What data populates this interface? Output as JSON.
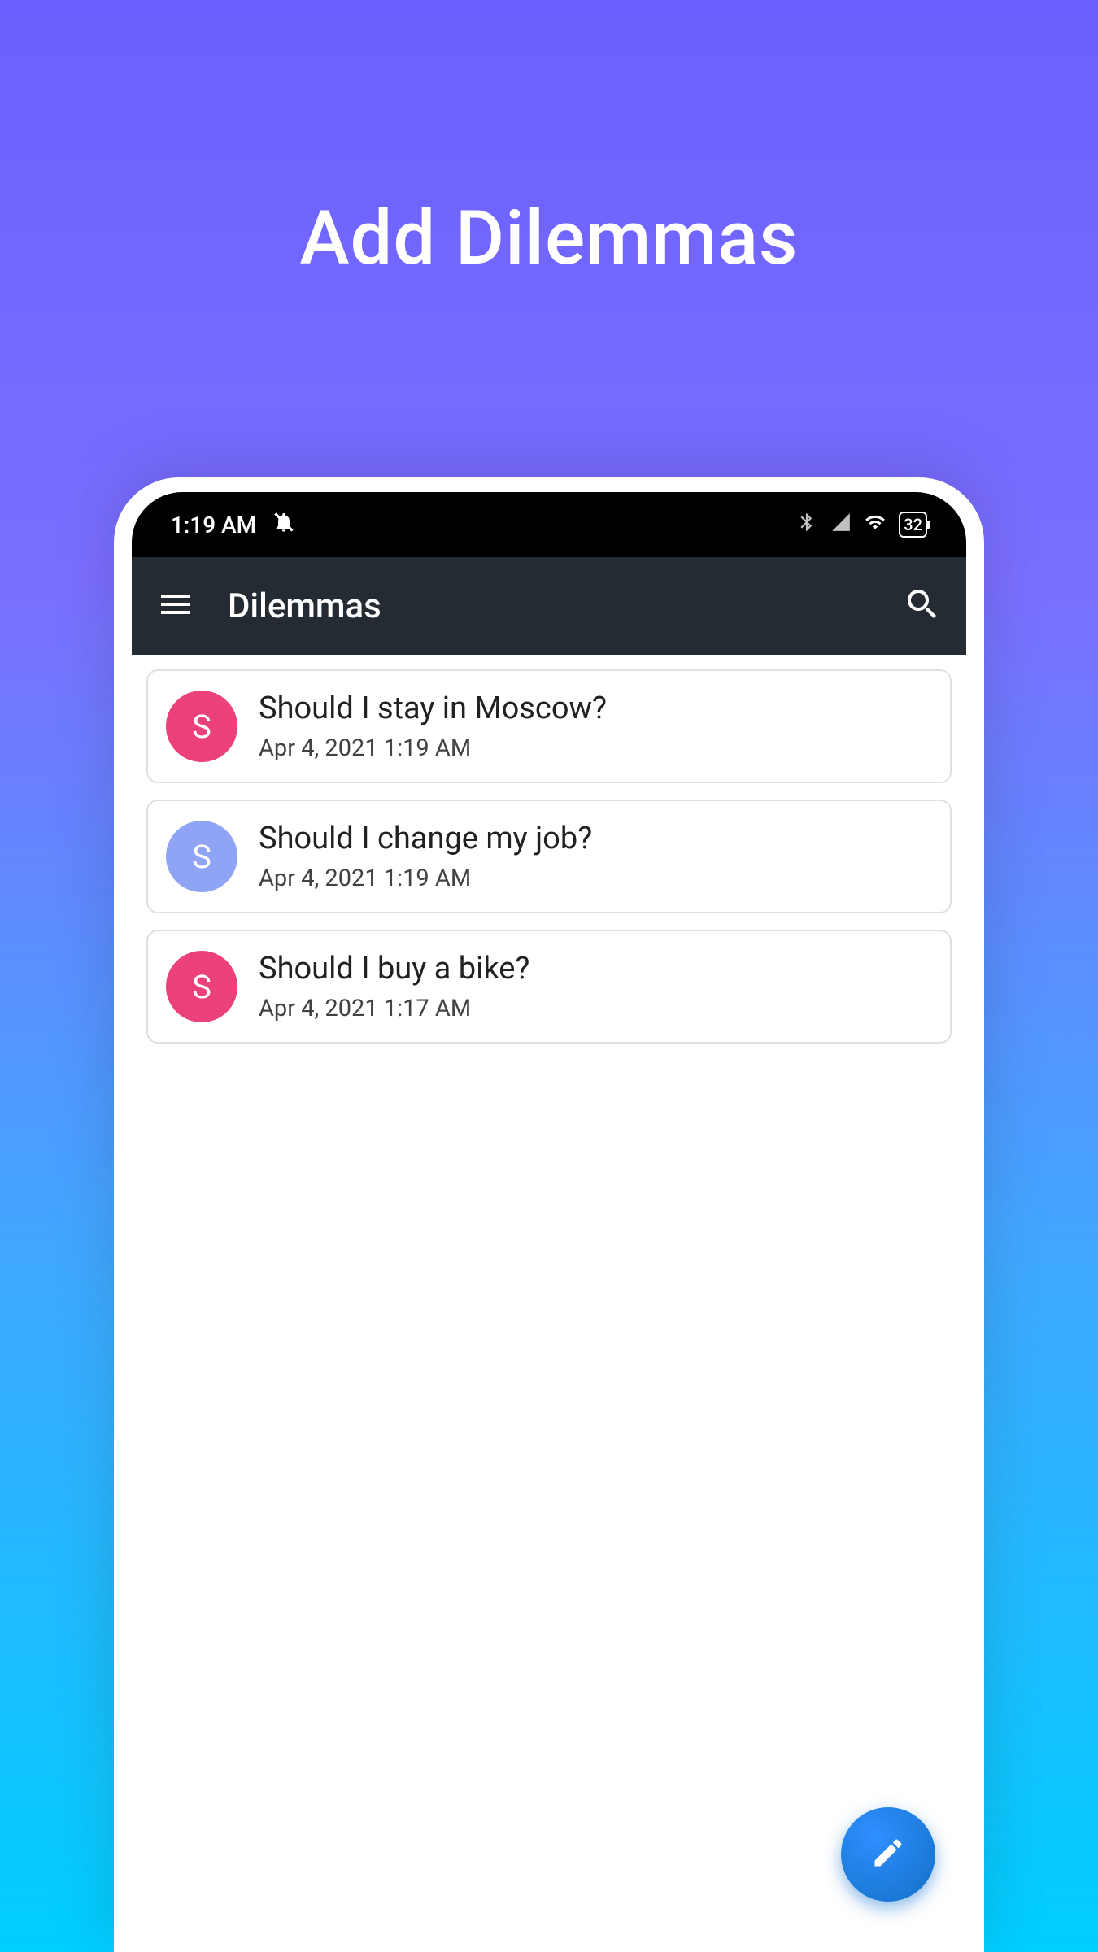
{
  "page": {
    "title": "Add Dilemmas"
  },
  "status_bar": {
    "time": "1:19 AM",
    "battery": "32"
  },
  "app_bar": {
    "title": "Dilemmas"
  },
  "dilemmas": [
    {
      "initial": "S",
      "title": "Should I stay in Moscow?",
      "date": "Apr 4, 2021 1:19 AM",
      "avatar_color": "pink"
    },
    {
      "initial": "S",
      "title": "Should I change my job?",
      "date": "Apr 4, 2021 1:19 AM",
      "avatar_color": "blue"
    },
    {
      "initial": "S",
      "title": "Should I buy a bike?",
      "date": "Apr 4, 2021 1:17 AM",
      "avatar_color": "pink"
    }
  ]
}
